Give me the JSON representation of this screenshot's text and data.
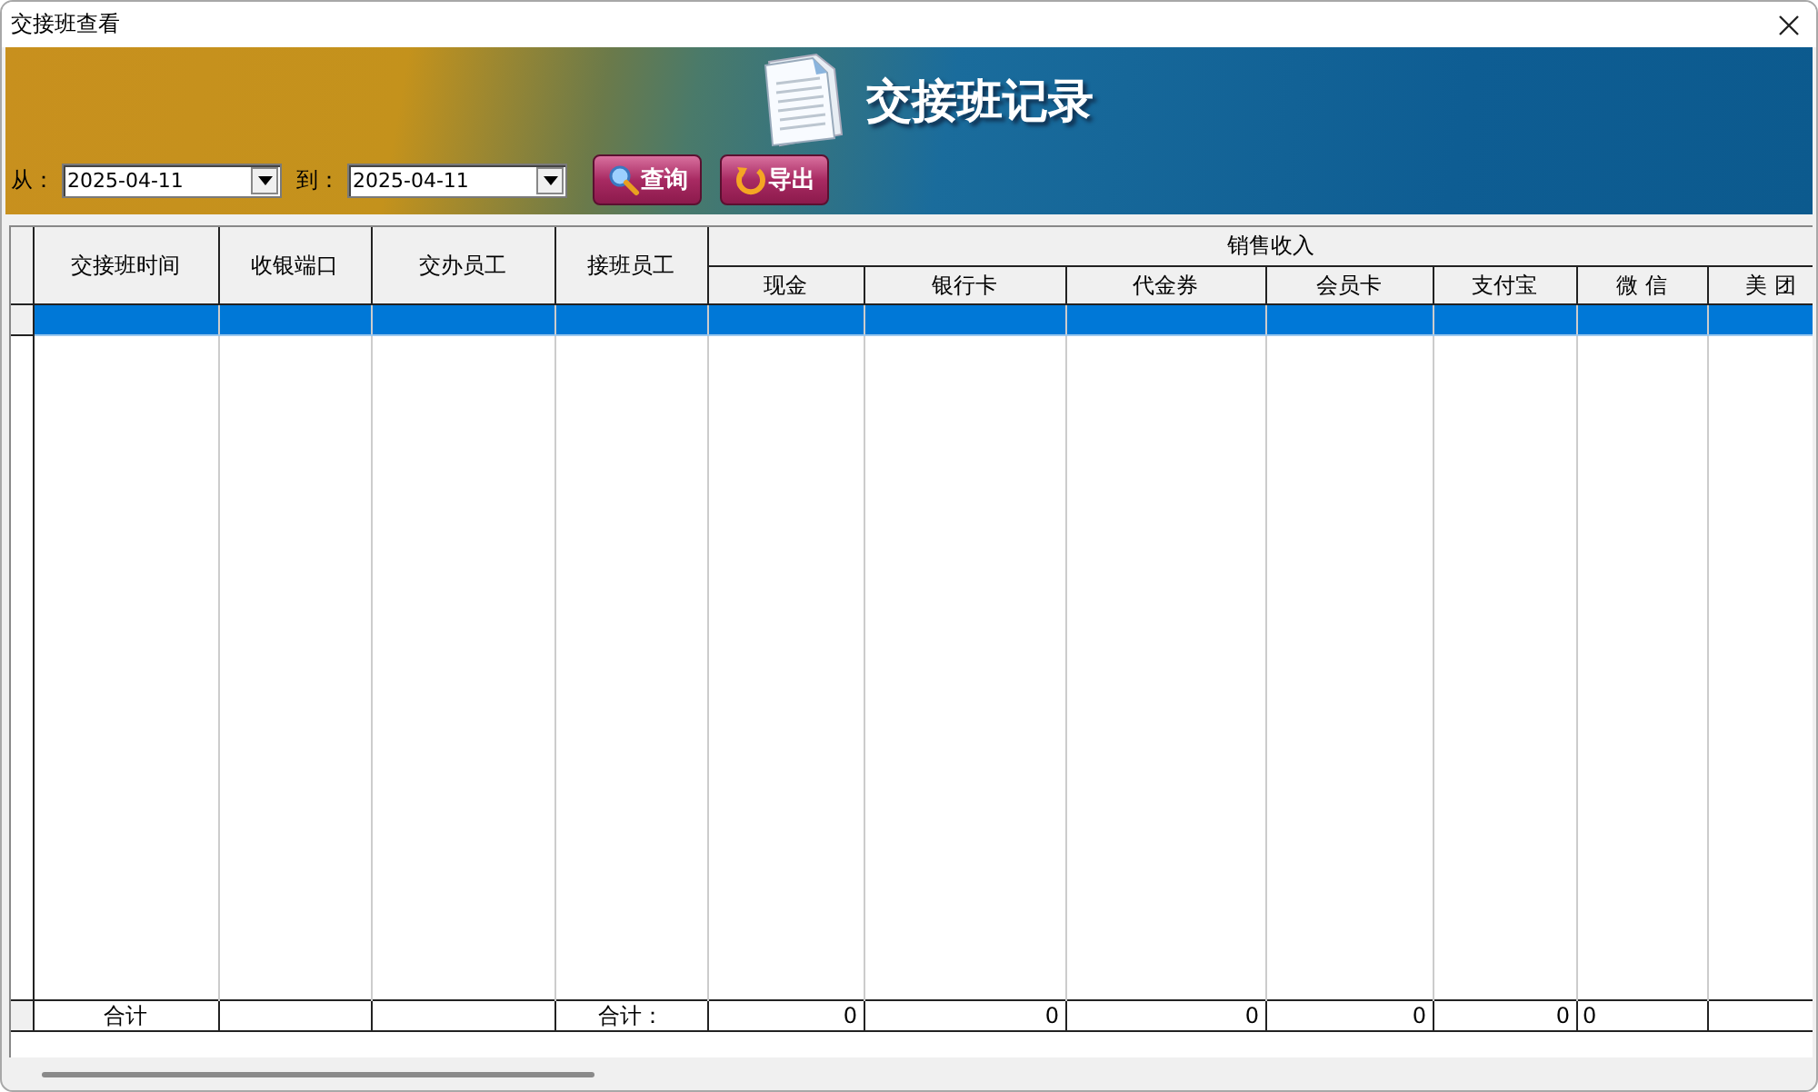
{
  "window": {
    "title": "交接班查看"
  },
  "banner": {
    "title": "交接班记录"
  },
  "filter": {
    "from_label": "从：",
    "from_date": "2025-04-11",
    "to_label": "到：",
    "to_date": "2025-04-11"
  },
  "buttons": [
    {
      "label": "查询",
      "kind": "search"
    },
    {
      "label": "导出",
      "kind": "export"
    }
  ],
  "table": {
    "columns": [
      "交接班时间",
      "收银端口",
      "交办员工",
      "接班员工"
    ],
    "group": {
      "label": "销售收入",
      "columns": [
        "现金",
        "银行卡",
        "代金券",
        "会员卡",
        "支付宝",
        "微 信",
        "美 团"
      ]
    },
    "rows": [
      {
        "selected": true
      }
    ],
    "footer": [
      {
        "text": "合计",
        "kind": "label"
      },
      {
        "kind": "label"
      },
      {
        "kind": "label"
      },
      {
        "text": "合计：",
        "kind": "label"
      },
      {
        "text": "0",
        "kind": "number"
      },
      {
        "text": "0",
        "kind": "number"
      },
      {
        "text": "0",
        "kind": "number"
      },
      {
        "text": "0",
        "kind": "number"
      },
      {
        "text": "0",
        "kind": "number"
      },
      {
        "text": "0",
        "kind": "text"
      },
      {
        "kind": "text"
      }
    ]
  }
}
